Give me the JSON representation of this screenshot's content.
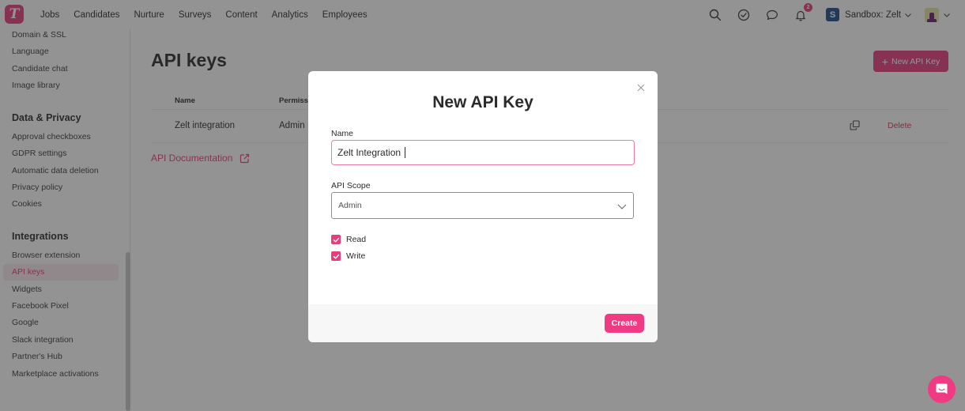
{
  "app": {
    "logo_letter": "T",
    "brand_color": "#e73c7e"
  },
  "topnav": {
    "items": [
      "Jobs",
      "Candidates",
      "Nurture",
      "Surveys",
      "Content",
      "Analytics",
      "Employees"
    ],
    "notifications_count": "2",
    "workspace_initial": "S",
    "workspace_name": "Sandbox: Zelt",
    "icons": [
      "search-icon",
      "check-circle-icon",
      "chat-icon",
      "bell-icon"
    ]
  },
  "sidebar": {
    "items_top": [
      "Domain & SSL",
      "Language",
      "Candidate chat",
      "Image library"
    ],
    "section_data_privacy": {
      "title": "Data & Privacy",
      "items": [
        "Approval checkboxes",
        "GDPR settings",
        "Automatic data deletion",
        "Privacy policy",
        "Cookies"
      ]
    },
    "section_integrations": {
      "title": "Integrations",
      "items": [
        "Browser extension",
        "API keys",
        "Widgets",
        "Facebook Pixel",
        "Google",
        "Slack integration",
        "Partner's Hub",
        "Marketplace activations"
      ],
      "active": "API keys"
    }
  },
  "main": {
    "title": "API keys",
    "new_button_label": "New API Key",
    "table": {
      "columns": [
        "Name",
        "Permiss"
      ],
      "rows": [
        {
          "name": "Zelt integration",
          "permission": "Admin",
          "delete_label": "Delete"
        }
      ]
    },
    "api_doc_link": "API Documentation"
  },
  "modal": {
    "title": "New API Key",
    "name_label": "Name",
    "name_value": "Zelt Integration",
    "scope_label": "API Scope",
    "scope_value": "Admin",
    "checkboxes": [
      {
        "label": "Read",
        "checked": true
      },
      {
        "label": "Write",
        "checked": true
      }
    ],
    "create_label": "Create"
  }
}
